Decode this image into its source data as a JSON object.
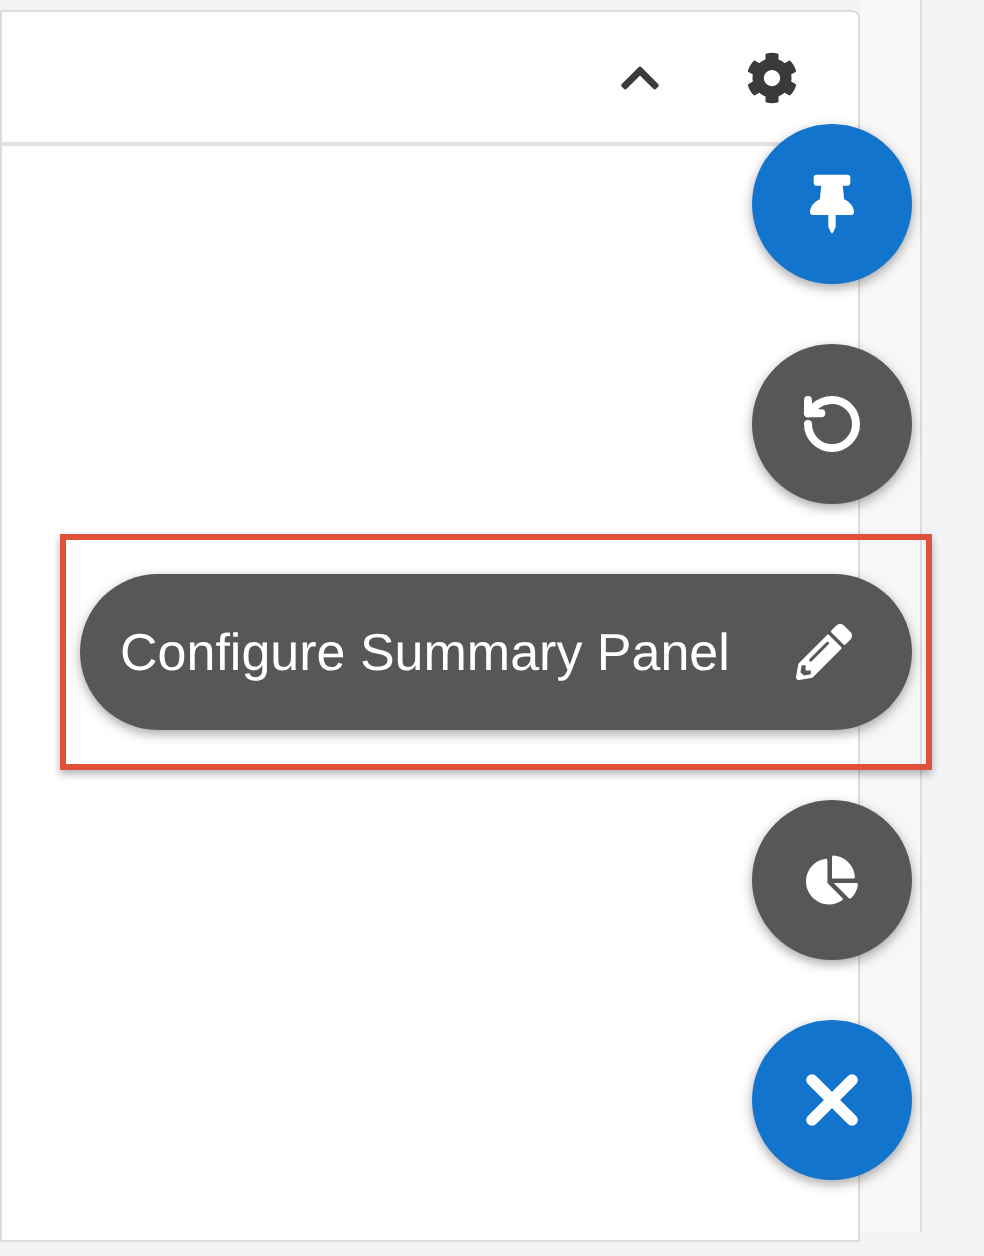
{
  "fab_menu": {
    "actions": [
      {
        "kind": "pin",
        "color": "#1274cc",
        "highlighted": false
      },
      {
        "kind": "undo",
        "color": "#575757",
        "highlighted": false
      },
      {
        "kind": "configure",
        "color": "#575757",
        "label": "Configure Summary Panel",
        "highlighted": true
      },
      {
        "kind": "chart",
        "color": "#575757",
        "highlighted": false
      },
      {
        "kind": "close",
        "color": "#1274cc",
        "highlighted": false
      }
    ]
  }
}
